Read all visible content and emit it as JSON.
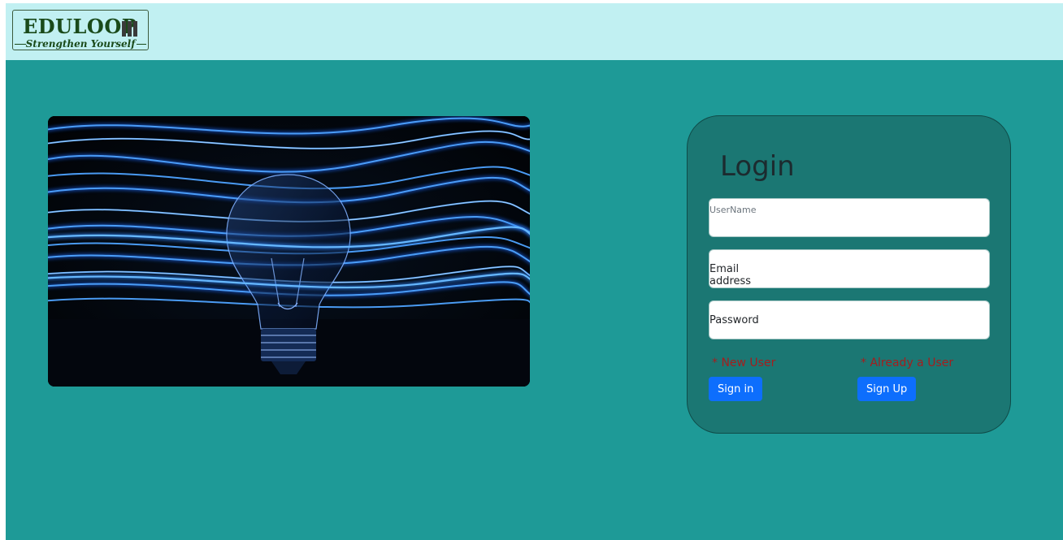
{
  "brand": {
    "name": "EDULOOP",
    "tagline": "Strengthen Yourself"
  },
  "login": {
    "title": "Login",
    "username_placeholder": "UserName",
    "email_placeholder": "Email address",
    "password_placeholder": "Password",
    "new_user_note": "* New User",
    "existing_user_note": "* Already a User",
    "sign_in_label": "Sign in",
    "sign_up_label": "Sign Up"
  },
  "colors": {
    "navbar": "#c1f0f2",
    "background": "#1e9a97",
    "card": "#1b7773",
    "button": "#0d6efd",
    "note": "#a41e1e"
  }
}
